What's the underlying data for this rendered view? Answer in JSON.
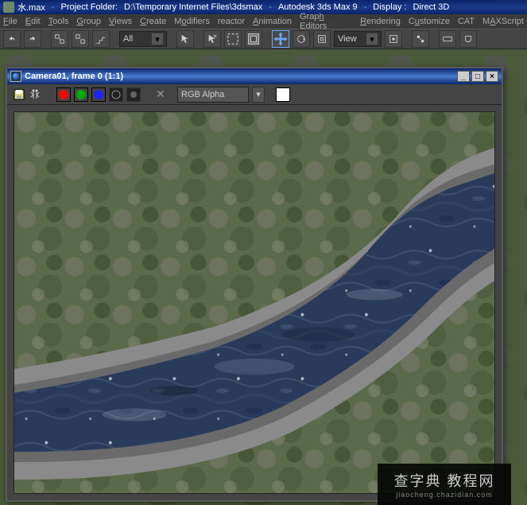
{
  "title": {
    "filename": "水.max",
    "folder_label": "Project Folder:",
    "folder_path": "D:\\Temporary Internet Files\\3dsmax",
    "app": "Autodesk 3ds Max 9",
    "display_label": "Display :",
    "display_mode": "Direct 3D"
  },
  "menu": {
    "file": "File",
    "edit": "Edit",
    "tools": "Tools",
    "group": "Group",
    "views": "Views",
    "create": "Create",
    "modifiers": "Modifiers",
    "reactor": "reactor",
    "animation": "Animation",
    "graph": "Graph Editors",
    "rendering": "Rendering",
    "customize": "Customize",
    "cat": "CAT",
    "maxscript": "MAXScript"
  },
  "toolbar": {
    "selection_filter": "All",
    "ref_system": "View"
  },
  "render_window": {
    "title": "Camera01, frame 0 (1:1)",
    "channel": "RGB Alpha"
  },
  "watermark": {
    "main": "查字典 教程网",
    "sub": "jiaocheng.chazidian.com"
  }
}
